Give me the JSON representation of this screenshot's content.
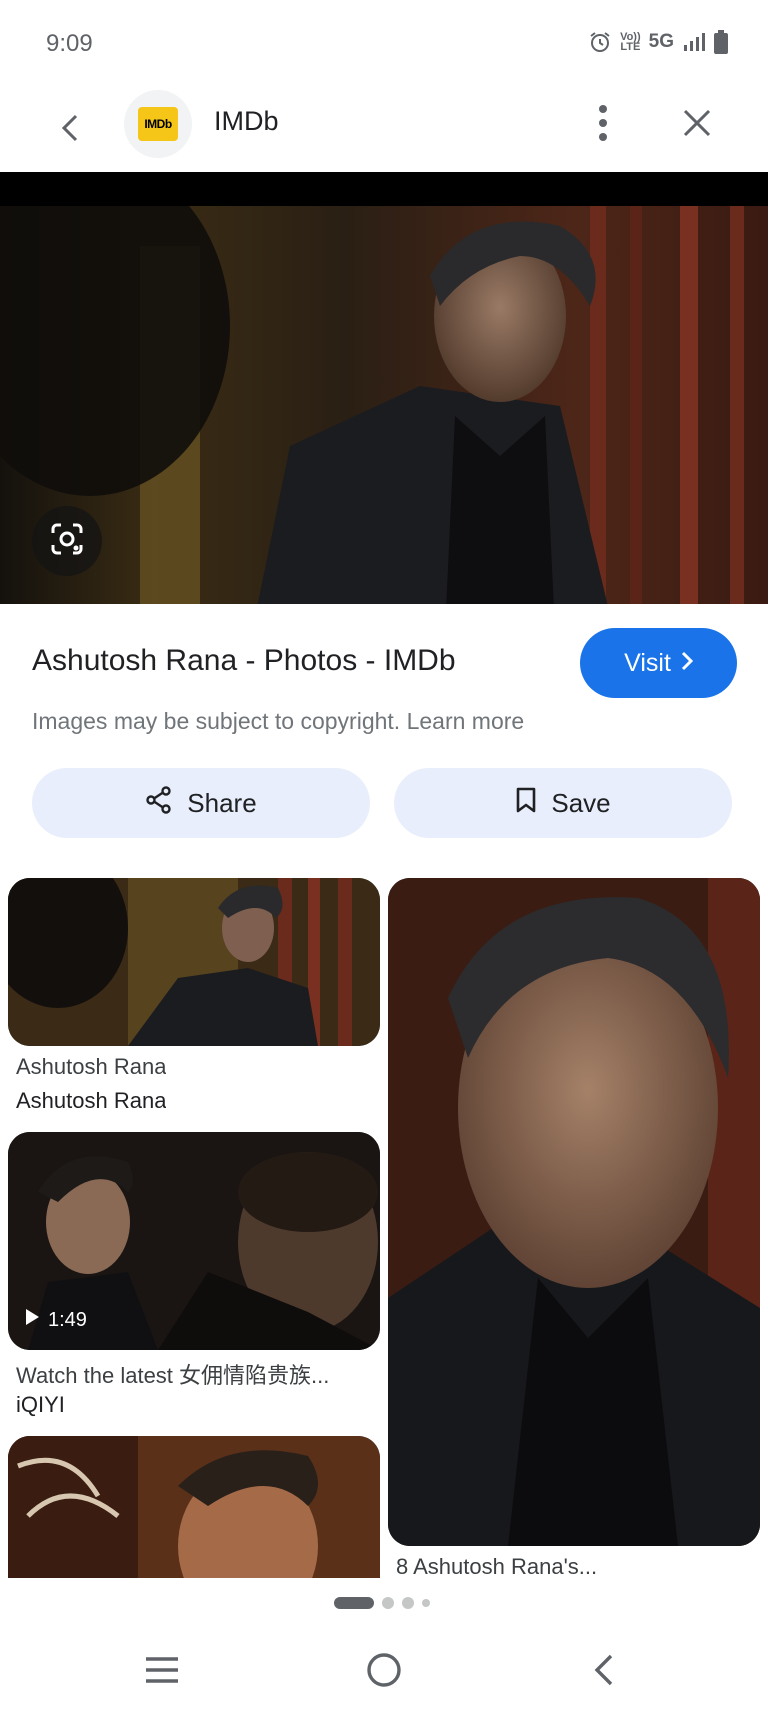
{
  "status_bar": {
    "time": "9:09",
    "volte_label": "Vo)) LTE",
    "network": "5G"
  },
  "app_bar": {
    "site_name": "IMDb",
    "logo_text": "IMDb",
    "icons": [
      "back-arrow-icon",
      "more-vert-icon",
      "close-icon"
    ]
  },
  "hero": {
    "lens_icon": "google-lens-icon"
  },
  "result": {
    "title": "Ashutosh Rana - Photos - IMDb",
    "visit_label": "Visit",
    "copyright_text": "Images may be subject to copyright.",
    "learn_more": "Learn more",
    "share_label": "Share",
    "save_label": "Save"
  },
  "related": [
    {
      "title": "Ashutosh Rana",
      "source": "Ashutosh Rana"
    },
    {
      "title": "Watch the latest 女佣情陷贵族...",
      "source": "iQIYI",
      "duration": "1:49"
    },
    {
      "title": "8 Ashutosh Rana's..."
    }
  ],
  "pager": {
    "pages": 4,
    "active": 0
  },
  "colors": {
    "accent": "#1a73e8",
    "imdb_yellow": "#f5c518",
    "chip_bg": "#e8eefb"
  }
}
